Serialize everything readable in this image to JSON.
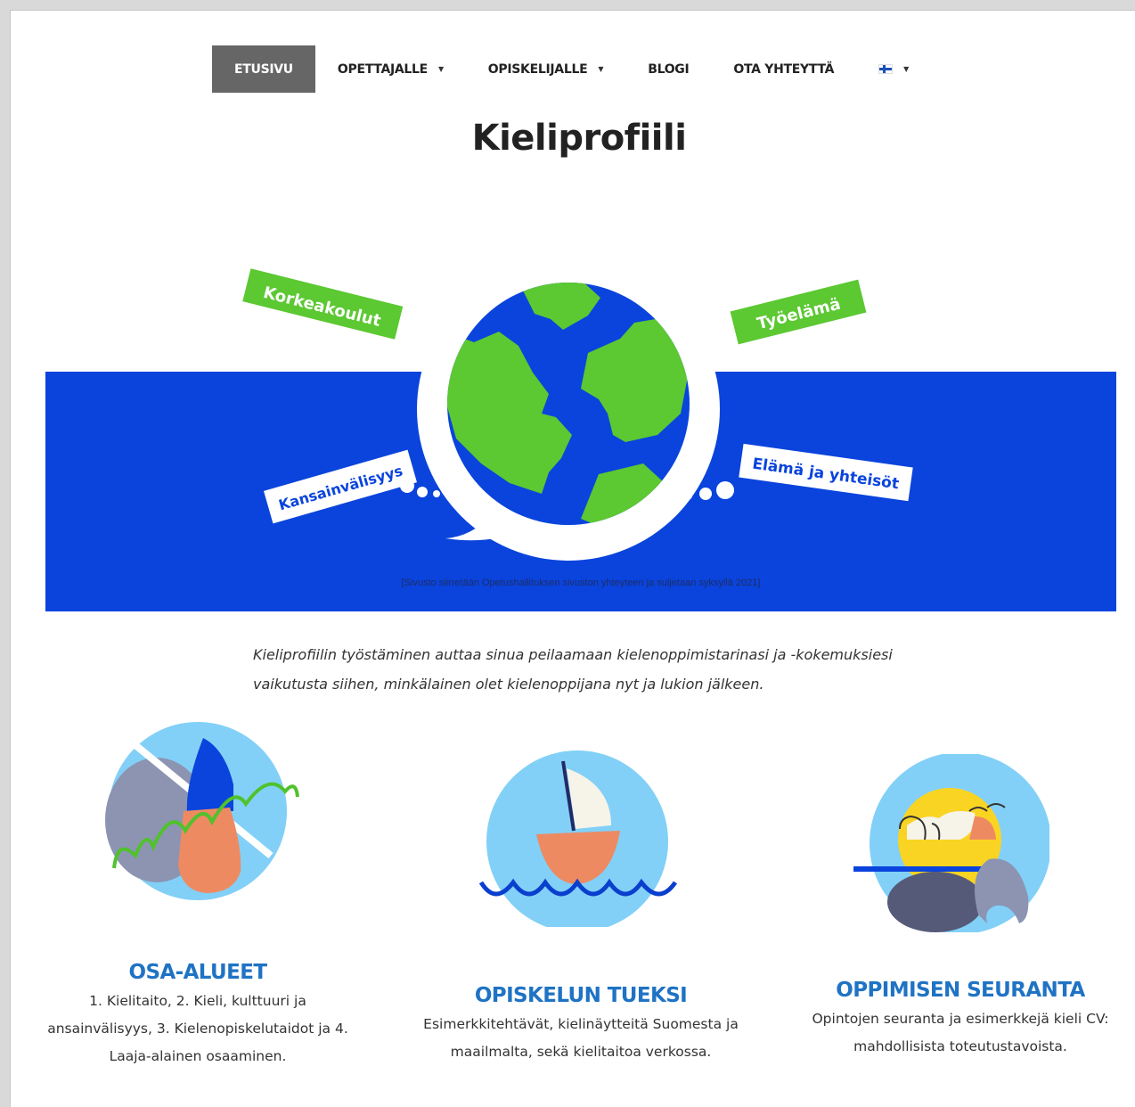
{
  "nav": {
    "items": [
      {
        "label": "ETUSIVU",
        "active": true
      },
      {
        "label": "OPETTAJALLE",
        "dropdown": true
      },
      {
        "label": "OPISKELIJALLE",
        "dropdown": true
      },
      {
        "label": "BLOGI"
      },
      {
        "label": "OTA YHTEYTTÄ"
      }
    ],
    "language": {
      "icon": "finnish-flag-icon",
      "dropdown": true
    }
  },
  "page_title": "Kieliprofiili",
  "hero": {
    "labels": {
      "top_left": "Korkeakoulut",
      "top_right": "Työelämä",
      "bottom_left": "Kansainvälisyys",
      "bottom_right": "Elämä ja yhteisöt"
    },
    "note": "[Sivusto siirretään Opetushallituksen sivuston yhteyteen ja suljetaan syksyllä 2021]",
    "colors": {
      "band": "#0a44dc",
      "label_green": "#5cc832",
      "globe_blue": "#0a44dc"
    }
  },
  "intro": {
    "line1": "Kieliprofiilin työstäminen auttaa sinua peilaamaan kielenoppimistarinasi ja -kokemuksiesi",
    "line2": "vaikutusta siihen, minkälainen olet kielenoppijana nyt ja lukion jälkeen."
  },
  "features": [
    {
      "icon": "hand-nature-icon",
      "title": "OSA-ALUEET",
      "lines": [
        "1. Kielitaito, 2. Kieli, kulttuuri ja",
        "ansainvälisyys, 3. Kielenopiskelutaidot ja 4.",
        "Laaja-alainen osaaminen."
      ]
    },
    {
      "icon": "sailboat-icon",
      "title": "OPISKELUN TUEKSI",
      "lines": [
        "Esimerkkitehtävät, kielinäytteitä Suomesta ja",
        "maailmalta, sekä kielitaitoa verkossa."
      ]
    },
    {
      "icon": "sunset-rocks-icon",
      "title": "OPPIMISEN SEURANTA",
      "lines": [
        "Opintojen seuranta ja esimerkkejä kieli CV:",
        "mahdollisista toteutustavoista."
      ]
    }
  ]
}
